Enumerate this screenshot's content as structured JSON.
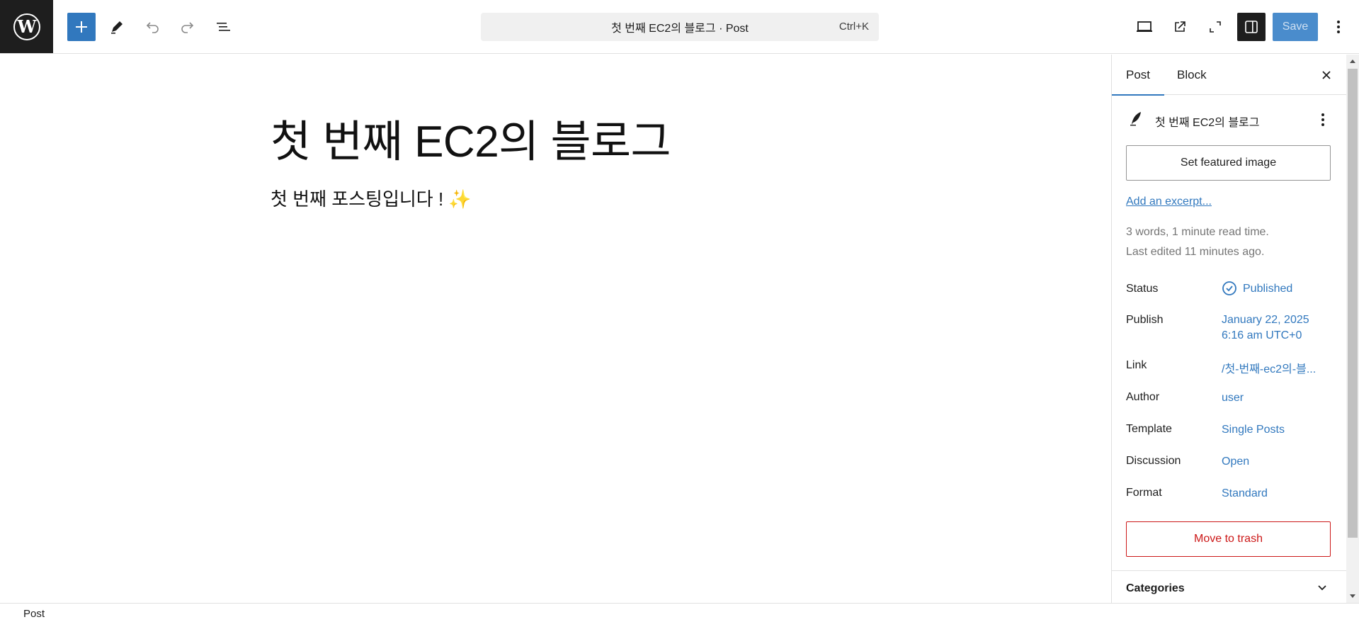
{
  "toolbar": {
    "command_bar_text": "첫 번째 EC2의 블로그 · Post",
    "command_shortcut": "Ctrl+K",
    "save_label": "Save"
  },
  "editor": {
    "title": "첫 번째 EC2의 블로그",
    "paragraph": "첫 번째 포스팅입니다 ! ✨"
  },
  "sidebar": {
    "tabs": [
      {
        "label": "Post",
        "active": true
      },
      {
        "label": "Block",
        "active": false
      }
    ],
    "post_title": "첫 번째 EC2의 블로그",
    "featured_image_button": "Set featured image",
    "excerpt_link": "Add an excerpt...",
    "stats": "3 words, 1 minute read time.",
    "last_edited": "Last edited 11 minutes ago.",
    "properties": {
      "status": {
        "label": "Status",
        "value": "Published"
      },
      "publish": {
        "label": "Publish",
        "value_line1": "January 22, 2025",
        "value_line2": "6:16 am UTC+0"
      },
      "link": {
        "label": "Link",
        "value": "/첫-번째-ec2의-블..."
      },
      "author": {
        "label": "Author",
        "value": "user"
      },
      "template": {
        "label": "Template",
        "value": "Single Posts"
      },
      "discussion": {
        "label": "Discussion",
        "value": "Open"
      },
      "format": {
        "label": "Format",
        "value": "Standard"
      }
    },
    "trash_button": "Move to trash",
    "categories_label": "Categories"
  },
  "footer": {
    "breadcrumb": "Post"
  },
  "colors": {
    "accent": "#3178be",
    "danger": "#cc1818",
    "dark": "#1e1e1e"
  }
}
